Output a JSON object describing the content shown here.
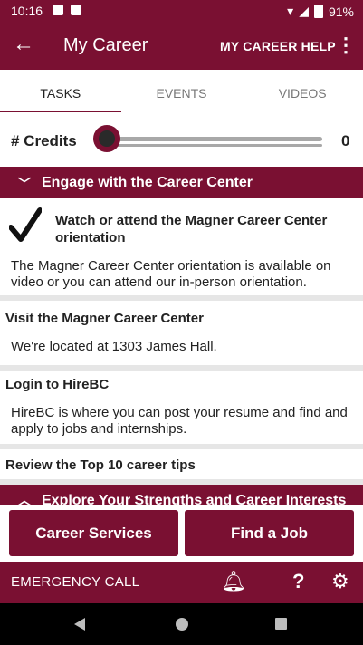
{
  "status": {
    "time": "10:16",
    "battery": "91%"
  },
  "appbar": {
    "title": "My Career",
    "help_label": "MY CAREER HELP"
  },
  "tabs": [
    {
      "label": "TASKS",
      "active": true
    },
    {
      "label": "EVENTS",
      "active": false
    },
    {
      "label": "VIDEOS",
      "active": false
    }
  ],
  "credits": {
    "label": "# Credits",
    "value": "0"
  },
  "sections": {
    "engage": {
      "title": "Engage with the Career Center",
      "expanded": true
    },
    "explore": {
      "title": "Explore Your Strengths and Career Interests",
      "expanded": false
    }
  },
  "tasks": [
    {
      "title": "Watch or attend the Magner Career Center orientation",
      "desc": "The Magner Career Center orientation is available on video or you can attend our in-person orientation.",
      "done": true
    },
    {
      "title": "Visit the Magner Career Center",
      "desc": "We're located at 1303 James Hall.",
      "done": false
    },
    {
      "title": "Login to HireBC",
      "desc": "HireBC is where you can post your resume and find and apply to jobs and internships.",
      "done": false
    },
    {
      "title": "Review the Top 10 career tips",
      "desc": "",
      "done": false
    }
  ],
  "buttons": {
    "career_services": "Career Services",
    "find_job": "Find a Job"
  },
  "bottom": {
    "emergency": "EMERGENCY CALL",
    "help_icon": "?"
  },
  "colors": {
    "primary": "#7a1032"
  }
}
